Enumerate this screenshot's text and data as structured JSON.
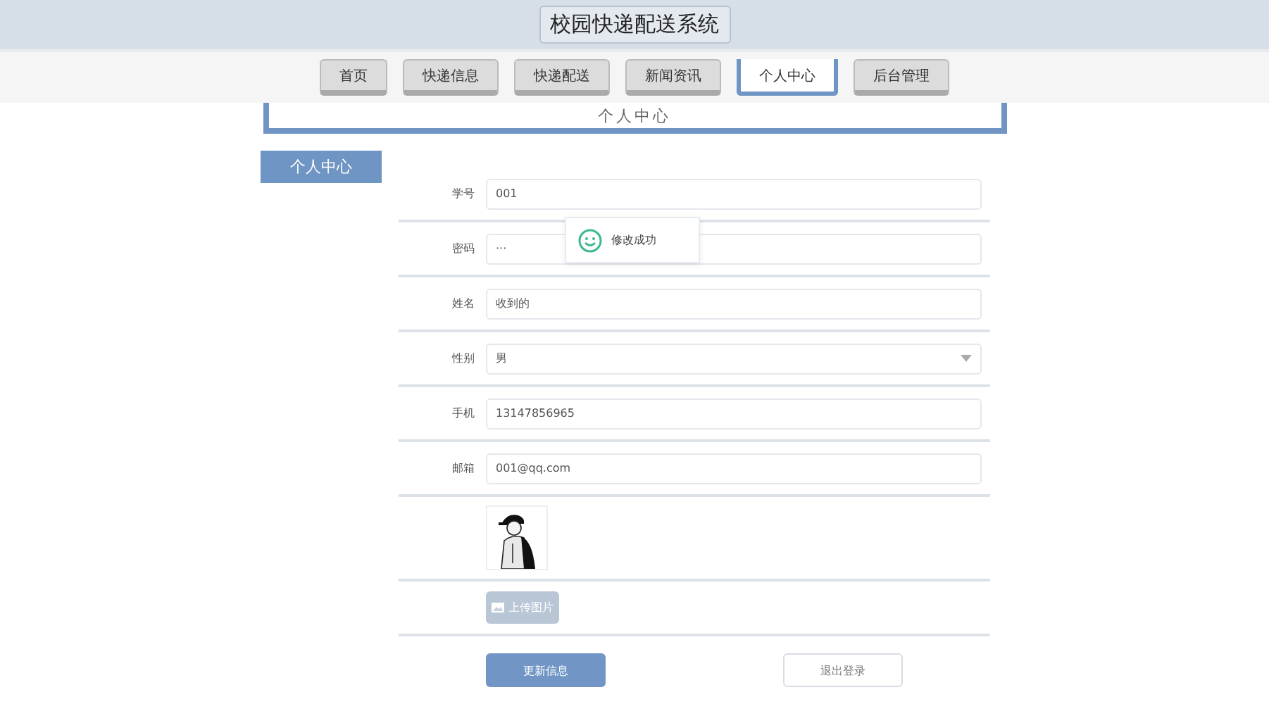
{
  "header": {
    "title": "校园快递配送系统"
  },
  "nav": [
    {
      "label": "首页",
      "selected": false
    },
    {
      "label": "快递信息",
      "selected": false
    },
    {
      "label": "快递配送",
      "selected": false
    },
    {
      "label": "新闻资讯",
      "selected": false
    },
    {
      "label": "个人中心",
      "selected": true
    },
    {
      "label": "后台管理",
      "selected": false
    }
  ],
  "banner": {
    "title": "个人中心"
  },
  "sidebar": {
    "items": [
      {
        "label": "个人中心",
        "selected": true
      }
    ]
  },
  "form": {
    "fields": [
      {
        "kind": "text",
        "label": "学号",
        "value": "001"
      },
      {
        "kind": "text",
        "label": "密码",
        "value": "···"
      },
      {
        "kind": "text",
        "label": "姓名",
        "value": "收到的"
      },
      {
        "kind": "select",
        "label": "性别",
        "value": "男"
      },
      {
        "kind": "text",
        "label": "手机",
        "value": "13147856965"
      },
      {
        "kind": "text",
        "label": "邮箱",
        "value": "001@qq.com"
      }
    ],
    "upload_button": {
      "label": "上传图片",
      "disabled": true
    },
    "buttons": [
      {
        "kind": "primary",
        "label": "更新信息"
      },
      {
        "kind": "plain",
        "label": "退出登录"
      }
    ]
  },
  "toast": {
    "message": "修改成功"
  }
}
